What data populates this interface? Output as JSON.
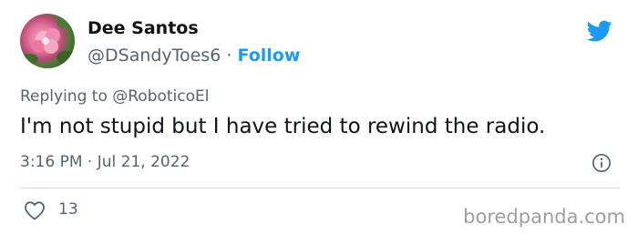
{
  "author": {
    "display_name": "Dee Santos",
    "handle": "@DSandyToes6",
    "separator": " · ",
    "follow_label": "Follow"
  },
  "reply": {
    "prefix": "Replying to ",
    "mention": "@RoboticoEl"
  },
  "tweet": {
    "text": "I'm not stupid but I have tried to rewind the radio.",
    "timestamp": "3:16 PM · Jul 21, 2022"
  },
  "engagement": {
    "like_count": "13"
  },
  "watermark": "boredpanda.com",
  "icons": {
    "brand": "twitter-bird-icon",
    "info": "info-icon",
    "like": "heart-icon"
  },
  "colors": {
    "accent": "#1d9bf0",
    "text": "#0f1419",
    "muted": "#536471",
    "divider": "#cfd9de"
  }
}
